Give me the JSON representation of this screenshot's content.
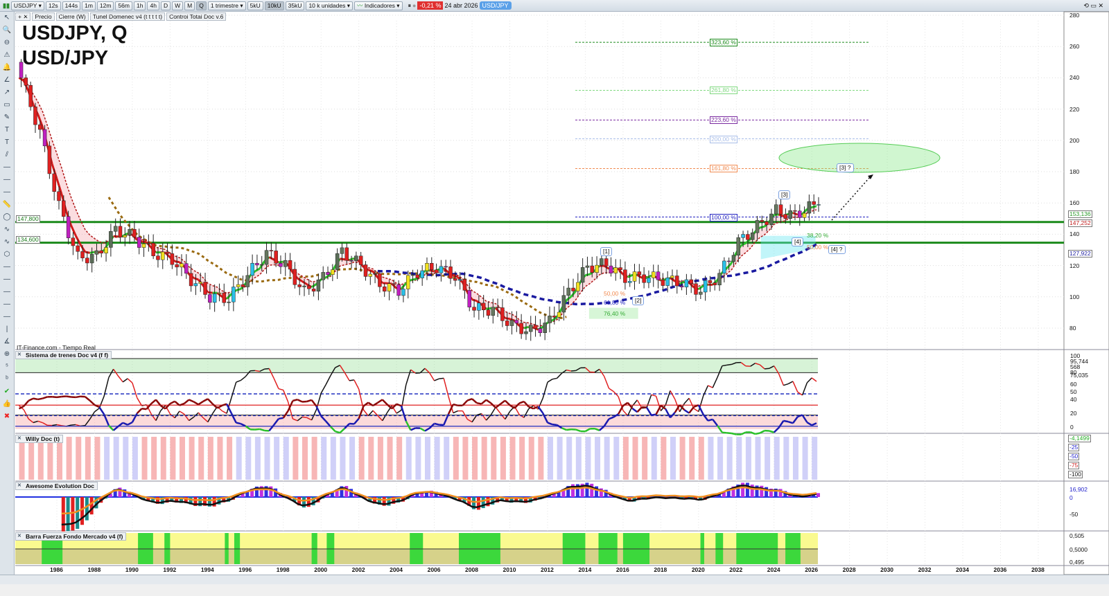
{
  "toolbar": {
    "symbol": "USDJPY",
    "timeframes": [
      "12s",
      "144s",
      "1m",
      "12m",
      "56m",
      "1h",
      "4h",
      "D",
      "W",
      "M",
      "Q"
    ],
    "active_tf": "Q",
    "period": "1 trimestre",
    "units_btns": [
      "5kU",
      "10kU",
      "35kU"
    ],
    "active_units": "10kU",
    "units": "10 k unidades",
    "indicators": "Indicadores",
    "change": "-0,21 %",
    "date": "24 abr 2026",
    "pair": "USD/JPY"
  },
  "legend": {
    "items": [
      "Precio",
      "Cierre (W)",
      "Tunel Domenec v4 (t t t t t)",
      "Control Total Doc v.6"
    ]
  },
  "title": {
    "line1": "USDJPY, Q",
    "line2": "USD/JPY"
  },
  "source": "IT-Finance.com - Tiempo Real",
  "panes": {
    "trenes": "Sistema de trenes Doc v4 (f f)",
    "willy": "Willy Doc (t)",
    "awesome": "Awesome Evolution Doc",
    "barra": "Barra Fuerza Fondo Mercado v4 (f)"
  },
  "levels": {
    "h1": "147,800",
    "h2": "134,600"
  },
  "fib": [
    {
      "label": "323,60 %",
      "price": 262.7,
      "color": "#1a8a1a"
    },
    {
      "label": "261,80 %",
      "price": 232,
      "color": "#7fd87f"
    },
    {
      "label": "223,60 %",
      "price": 213,
      "color": "#7a2aa0"
    },
    {
      "label": "200,00 %",
      "price": 201,
      "color": "#a8bde8"
    },
    {
      "label": "161,80 %",
      "price": 182,
      "color": "#f08a50"
    },
    {
      "label": "100,00 %",
      "price": 151,
      "color": "#2020c0"
    }
  ],
  "wave_labels": {
    "w1": "[1]",
    "w2": "[2]",
    "w3": "[3]",
    "w4": "[4]",
    "w4q": "[4] ?",
    "w3q": "[3] ?",
    "f382": "38,20 %",
    "f50": "50,00 %",
    "f50b": "50,00 %",
    "f618": "61,80 %",
    "f764": "76,40 %"
  },
  "price_axis": {
    "ticks": [
      80,
      100,
      120,
      140,
      160,
      180,
      200,
      220,
      240,
      260,
      280
    ],
    "marks": [
      {
        "v": "153,136",
        "p": 153.1,
        "c": "#2a9a2a"
      },
      {
        "v": "147,252",
        "p": 147.25,
        "c": "#c02020"
      },
      {
        "v": "127,922",
        "p": 127.9,
        "c": "#2020a0"
      }
    ]
  },
  "trenes_axis": [
    "100",
    "95,744",
    "568",
    "80",
    "75,035",
    "60",
    "50",
    "40",
    "20",
    "0"
  ],
  "willy_axis": [
    "-4,1499",
    "-25",
    "-50",
    "-75",
    "-100"
  ],
  "awesome_axis": [
    "16,902",
    "0",
    "-50"
  ],
  "barra_axis": [
    "0,505",
    "0,5000",
    "0,495"
  ],
  "years": [
    "1986",
    "1988",
    "1990",
    "1992",
    "1994",
    "1996",
    "1998",
    "2000",
    "2002",
    "2004",
    "2006",
    "2008",
    "2010",
    "2012",
    "2014",
    "2016",
    "2018",
    "2020",
    "2022",
    "2024",
    "2026",
    "2028",
    "2030",
    "2032",
    "2034",
    "2036",
    "2038"
  ],
  "chart_data": {
    "type": "candlestick",
    "title": "USDJPY, Q",
    "x_start": 1984,
    "ylim": [
      70,
      285
    ],
    "yearly_close": [
      [
        1984,
        240
      ],
      [
        1985,
        205
      ],
      [
        1986,
        158
      ],
      [
        1987,
        125
      ],
      [
        1988,
        126
      ],
      [
        1989,
        143
      ],
      [
        1990,
        138
      ],
      [
        1991,
        128
      ],
      [
        1992,
        124
      ],
      [
        1993,
        111
      ],
      [
        1994,
        100
      ],
      [
        1995,
        99
      ],
      [
        1996,
        114
      ],
      [
        1997,
        128
      ],
      [
        1998,
        120
      ],
      [
        1999,
        103
      ],
      [
        2000,
        112
      ],
      [
        2001,
        129
      ],
      [
        2002,
        120
      ],
      [
        2003,
        108
      ],
      [
        2004,
        104
      ],
      [
        2005,
        116
      ],
      [
        2006,
        119
      ],
      [
        2007,
        113
      ],
      [
        2008,
        92
      ],
      [
        2009,
        92
      ],
      [
        2010,
        82
      ],
      [
        2011,
        78
      ],
      [
        2012,
        84
      ],
      [
        2013,
        103
      ],
      [
        2014,
        119
      ],
      [
        2015,
        121
      ],
      [
        2016,
        112
      ],
      [
        2017,
        113
      ],
      [
        2018,
        111
      ],
      [
        2019,
        109
      ],
      [
        2020,
        104
      ],
      [
        2021,
        114
      ],
      [
        2022,
        135
      ],
      [
        2023,
        145
      ],
      [
        2024,
        155
      ],
      [
        2025,
        152
      ],
      [
        2026,
        159
      ]
    ],
    "barra_green": [
      [
        1985.2,
        1986.3
      ],
      [
        1990.3,
        1991.1
      ],
      [
        1991.7,
        1992
      ],
      [
        1994.9,
        1995.1
      ],
      [
        1995.4,
        1995.7
      ],
      [
        1999.5,
        1999.8
      ],
      [
        2000.3,
        2000.7
      ],
      [
        2004.7,
        2005.4
      ],
      [
        2007.3,
        2009.5
      ],
      [
        2012.8,
        2014
      ],
      [
        2014.7,
        2015.7
      ],
      [
        2016,
        2017.4
      ],
      [
        2020.1,
        2020.3
      ],
      [
        2020.9,
        2021.3
      ],
      [
        2022,
        2024.2
      ],
      [
        2024.6,
        2025.4
      ]
    ]
  }
}
